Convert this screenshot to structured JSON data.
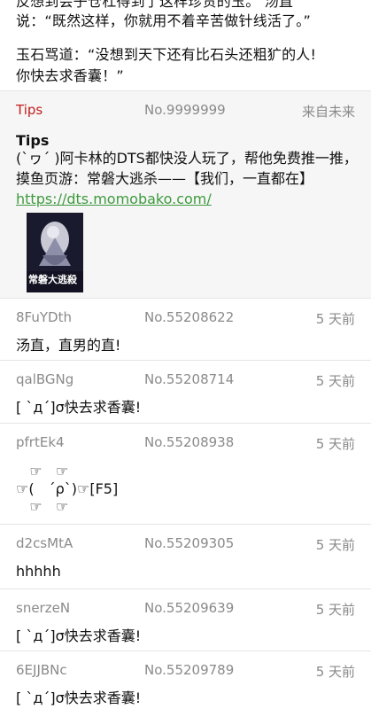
{
  "story": {
    "line1": "反想到会子仓杠得到了这样珍贵的玉。 汤直",
    "line2": "说：“既然这样，你就用不着辛苦做针线活了。”",
    "line3": "玉石骂道：“没想到天下还有比石头还粗犷的人!",
    "line4": "你快去求香囊！”"
  },
  "tips": {
    "user": "Tips",
    "no": "No.9999999",
    "time": "来自未来",
    "title": "Tips",
    "body_text": "(`ヮ´ )阿卡林的DTS都快没人玩了，帮他免费推一推，摸鱼页游：常磐大逃杀——【我们，一直都在】",
    "link": "https://dts.momobako.com/",
    "thumb_text": "常磐大逃殺"
  },
  "replies": [
    {
      "user": "8FuYDth",
      "no": "No.55208622",
      "time": "5 天前",
      "content": "汤直，直男的直!"
    },
    {
      "user": "qalBGNg",
      "no": "No.55208714",
      "time": "5 天前",
      "content": "[ `д´]σ快去求香囊!"
    },
    {
      "user": "pfrtEk4",
      "no": "No.55208938",
      "time": "5 天前",
      "content": "   ☞   ☞\n☞(　´ρ`)☞[F5]\n   ☞   ☞"
    },
    {
      "user": "d2csMtA",
      "no": "No.55209305",
      "time": "5 天前",
      "content": "hhhhh"
    },
    {
      "user": "snerzeN",
      "no": "No.55209639",
      "time": "5 天前",
      "content": "[ `д´]σ快去求香囊!"
    },
    {
      "user": "6EJJBNc",
      "no": "No.55209789",
      "time": "5 天前",
      "content": "[ `д´]σ快去求香囊!"
    }
  ]
}
